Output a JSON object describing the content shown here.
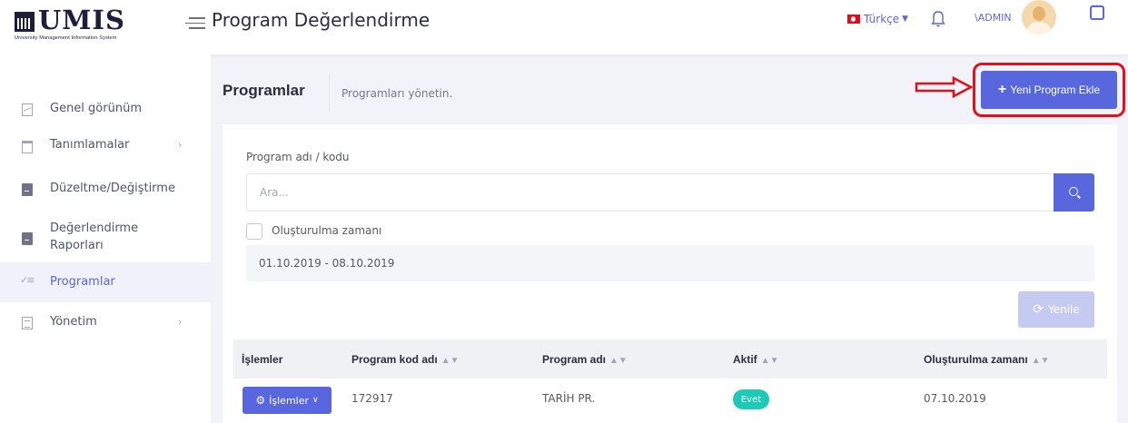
{
  "header": {
    "logo_text": "UMIS",
    "logo_subtitle": "University Management Information System",
    "app_title": "Program Değerlendirme",
    "language": "Türkçe",
    "user": "\\ADMIN"
  },
  "sidebar": {
    "items": [
      {
        "label": "Genel görünüm"
      },
      {
        "label": "Tanımlamalar"
      },
      {
        "label": "Düzeltme/Değiştirme"
      },
      {
        "label": "Değerlendirme Raporları"
      },
      {
        "label": "Programlar"
      },
      {
        "label": "Yönetim"
      }
    ]
  },
  "subheader": {
    "title": "Programlar",
    "description": "Programları yönetin.",
    "add_button": "Yeni Program Ekle"
  },
  "filters": {
    "program_label": "Program adı / kodu",
    "search_placeholder": "Ara...",
    "created_label": "Oluşturulma zamanı",
    "date_range": "01.10.2019 - 08.10.2019",
    "refresh_button": "Yenile"
  },
  "table": {
    "columns": [
      "İşlemler",
      "Program kod adı",
      "Program adı",
      "Aktif",
      "Oluşturulma zamanı"
    ],
    "rows": [
      {
        "ops": "İşlemler",
        "code": "172917",
        "name": "TARİH PR.",
        "active": "Evet",
        "created": "07.10.2019"
      }
    ]
  },
  "colors": {
    "primary": "#5867dd",
    "success": "#1dc9b7",
    "highlight": "#e3101c"
  }
}
